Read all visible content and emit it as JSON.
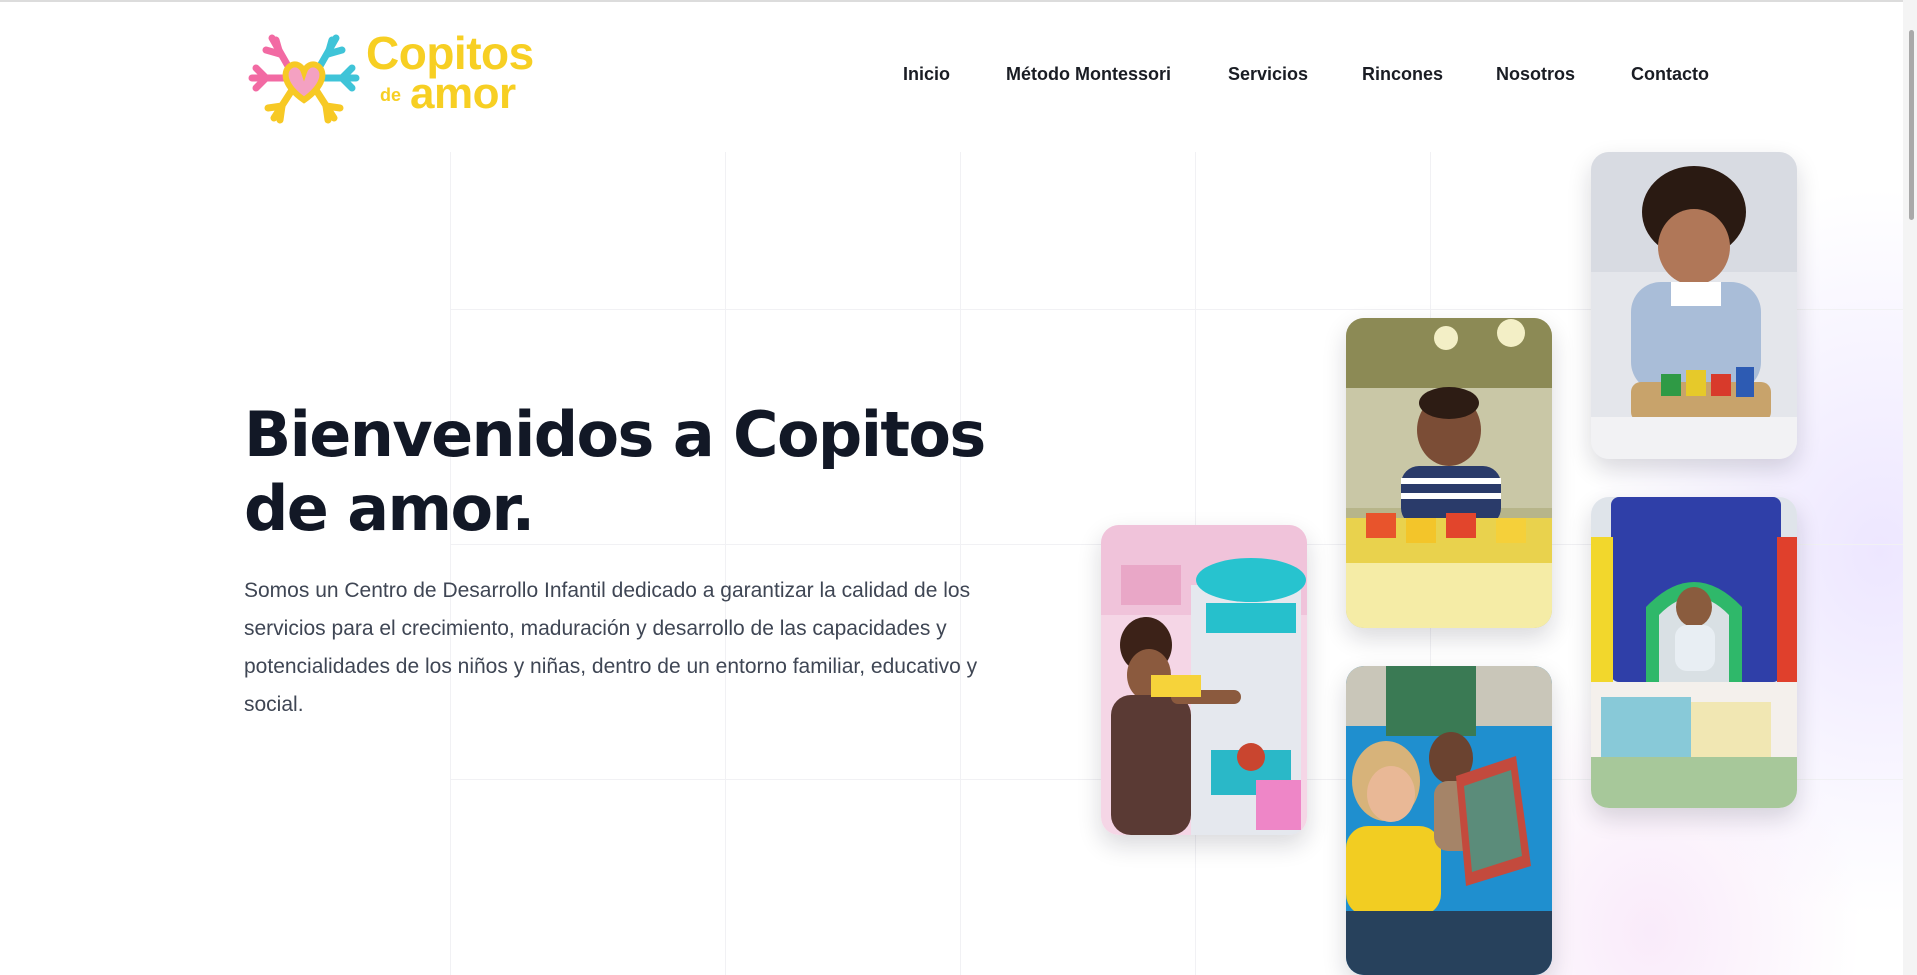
{
  "brand": {
    "name_line1": "Copitos",
    "name_small": "de",
    "name_line2": "amor"
  },
  "nav": {
    "items": [
      {
        "label": "Inicio"
      },
      {
        "label": "Método Montessori"
      },
      {
        "label": "Servicios"
      },
      {
        "label": "Rincones"
      },
      {
        "label": "Nosotros"
      },
      {
        "label": "Contacto"
      }
    ]
  },
  "hero": {
    "title": "Bienvenidos a Copitos de amor.",
    "description": "Somos un Centro de Desarrollo Infantil dedicado a garantizar la calidad de los servicios para el crecimiento, maduración y desarrollo de las capacidades y potencialidades de los niños y niñas, dentro de un entorno familiar, educativo y social."
  },
  "colors": {
    "brand_yellow": "#f7cf23",
    "brand_pink": "#f06fa5",
    "brand_teal": "#46c6d6",
    "heading": "#121826",
    "body_text": "#3f4654"
  },
  "photos": [
    {
      "icon": "child-playing-toy-kitchen-photo"
    },
    {
      "icon": "baby-playing-blocks-photo"
    },
    {
      "icon": "teacher-reading-to-child-photo"
    },
    {
      "icon": "toddler-stacking-toy-photo"
    },
    {
      "icon": "child-crawling-play-tunnel-photo"
    }
  ]
}
